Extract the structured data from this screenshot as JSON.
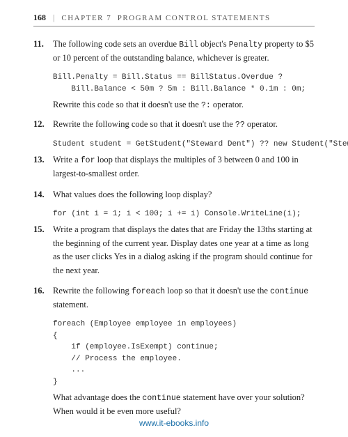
{
  "header": {
    "page_number": "168",
    "divider": "|",
    "chapter_label": "CHAPTER 7",
    "section_label": "PROGRAM CONTROL STATEMENTS"
  },
  "questions": [
    {
      "number": "11.",
      "text": "The following code sets an overdue Bill object's Penalty property to $5 or 10 percent of the outstanding balance, whichever is greater.",
      "code": [
        "Bill.Penalty = Bill.Status == BillStatus.Overdue ?",
        "    Bill.Balance < 50m ? 5m : Bill.Balance * 0.1m : 0m;"
      ],
      "followup": "Rewrite this code so that it doesn't use the ?: operator."
    },
    {
      "number": "12.",
      "text": "Rewrite the following code so that it doesn't use the ?? operator.",
      "code": [
        "Student student = GetStudent(\"Steward Dent\") ?? new Student(\"Steward Dent\");"
      ]
    },
    {
      "number": "13.",
      "text": "Write a for loop that displays the multiples of 3 between 0 and 100 in largest-to-smallest order."
    },
    {
      "number": "14.",
      "text": "What values does the following loop display?",
      "code": [
        "for (int i = 1; i < 100; i += i) Console.WriteLine(i);"
      ]
    },
    {
      "number": "15.",
      "text": "Write a program that displays the dates that are Friday the 13ths starting at the beginning of the current year. Display dates one year at a time as long as the user clicks Yes in a dialog asking if the program should continue for the next year."
    },
    {
      "number": "16.",
      "text": "Rewrite the following foreach loop so that it doesn't use the continue statement.",
      "code": [
        "foreach (Employee employee in employees)",
        "{",
        "    if (employee.IsExempt) continue;",
        "",
        "    // Process the employee.",
        "    ...",
        "}"
      ],
      "followup": "What advantage does the continue statement have over your solution? When would it be even more useful?"
    }
  ],
  "footer": {
    "link_text": "www.it-ebooks.info",
    "link_url": "http://www.it-ebooks.info"
  }
}
